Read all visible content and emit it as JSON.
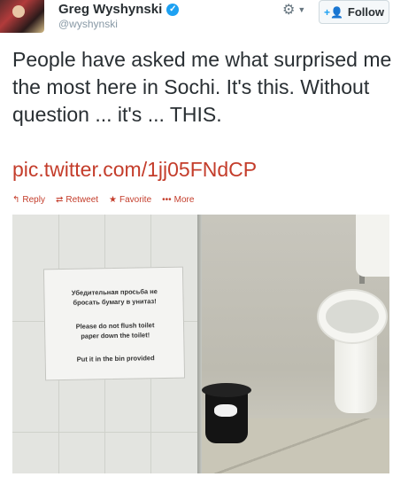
{
  "header": {
    "name": "Greg Wyshynski",
    "handle": "@wyshynski",
    "verified_icon": "verified-icon",
    "gear_icon": "gear-icon",
    "follow_label": "Follow"
  },
  "tweet": {
    "text": "People have asked me what surprised me the most here in Sochi. It's this. Without question ... it's ... THIS.",
    "link": "pic.twitter.com/1jj05FNdCP"
  },
  "actions": {
    "reply": "Reply",
    "retweet": "Retweet",
    "favorite": "Favorite",
    "more": "More"
  },
  "sign": {
    "ru_line1": "Убедительная просьба не",
    "ru_line2": "бросать бумагу в унитаз!",
    "en_line1": "Please do not flush toilet",
    "en_line2": "paper down the toilet!",
    "en_line3": "Put it in the bin provided"
  },
  "colors": {
    "link": "#c43d2b",
    "verified": "#1da1f2",
    "text": "#292f33"
  }
}
